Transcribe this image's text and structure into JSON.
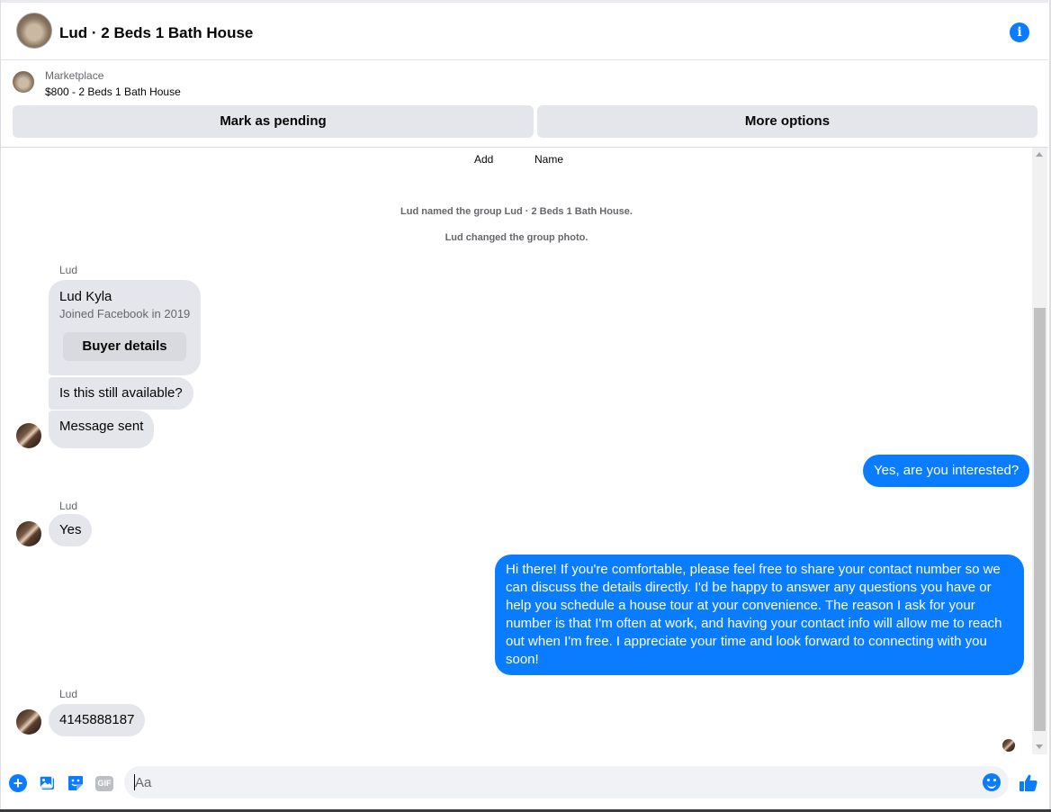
{
  "header": {
    "title": "Lud · 2 Beds 1 Bath House",
    "avatar_icon": "house-photo",
    "info_icon_glyph": "i"
  },
  "marketplace": {
    "label": "Marketplace",
    "item": "$800 - 2 Beds 1 Bath House",
    "mark_pending_label": "Mark as pending",
    "more_options_label": "More options"
  },
  "thread": {
    "top_actions": [
      "Add",
      "Name"
    ],
    "system_messages": [
      "Lud named the group Lud · 2 Beds 1 Bath House.",
      "Lud changed the group photo."
    ],
    "buyer_card": {
      "sender": "Lud",
      "name": "Lud Kyla",
      "joined": "Joined Facebook in 2019",
      "button_label": "Buyer details"
    },
    "messages": [
      {
        "from": "Lud",
        "text": "Is this still available?"
      },
      {
        "from": "Lud",
        "text": "Message sent"
      },
      {
        "from": "me",
        "text": "Yes, are you interested?"
      },
      {
        "from": "Lud",
        "sender_label": "Lud",
        "text": "Yes"
      },
      {
        "from": "me",
        "text": "Hi there! If you're comfortable, please feel free to share your contact number so we can discuss the details directly. I'd be happy to answer any questions you have or help you schedule a house tour at your convenience. The reason I ask for your number is that I'm often at work, and having your contact info will allow me to reach out when I'm free. I appreciate your time and look forward to connecting with you soon!"
      },
      {
        "from": "Lud",
        "sender_label": "Lud",
        "text": "4145888187"
      }
    ]
  },
  "composer": {
    "placeholder": "Aa",
    "gif_label": "GIF",
    "icons": [
      "plus-icon",
      "photo-icon",
      "sticker-icon",
      "gif-icon",
      "emoji-icon",
      "like-icon"
    ]
  },
  "colors": {
    "accent": "#0a7cff",
    "bubble_in": "#e4e6eb",
    "secondary_text": "#65676b"
  }
}
